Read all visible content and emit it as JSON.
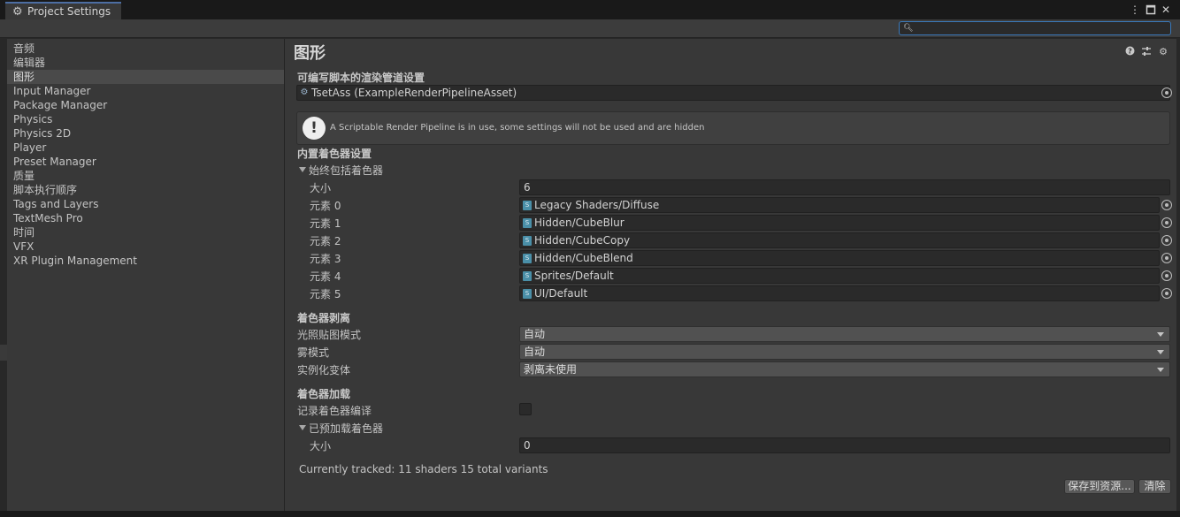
{
  "window": {
    "tab_title": "Project Settings",
    "menu_icon": "kebab-menu-icon",
    "maximize_icon": "maximize-icon",
    "close_icon": "close-icon"
  },
  "search": {
    "placeholder": "",
    "value": "",
    "icon": "search-icon"
  },
  "sidebar": {
    "items": [
      {
        "label": "音频",
        "selected": false
      },
      {
        "label": "编辑器",
        "selected": false
      },
      {
        "label": "图形",
        "selected": true
      },
      {
        "label": "Input Manager",
        "selected": false
      },
      {
        "label": "Package Manager",
        "selected": false
      },
      {
        "label": "Physics",
        "selected": false
      },
      {
        "label": "Physics 2D",
        "selected": false
      },
      {
        "label": "Player",
        "selected": false
      },
      {
        "label": "Preset Manager",
        "selected": false
      },
      {
        "label": "质量",
        "selected": false
      },
      {
        "label": "脚本执行顺序",
        "selected": false
      },
      {
        "label": "Tags and Layers",
        "selected": false
      },
      {
        "label": "TextMesh Pro",
        "selected": false
      },
      {
        "label": "时间",
        "selected": false
      },
      {
        "label": "VFX",
        "selected": false
      },
      {
        "label": "XR Plugin Management",
        "selected": false
      }
    ]
  },
  "main": {
    "title": "图形",
    "header_icons": [
      "help-icon",
      "preset-icon",
      "gear-icon"
    ],
    "srp": {
      "section": "可编写脚本的渲染管道设置",
      "asset_value": "TsetAss (ExampleRenderPipelineAsset)"
    },
    "help_message": "A Scriptable Render Pipeline is in use, some settings will not be used and are hidden",
    "builtin": {
      "section": "内置着色器设置",
      "always_include_label": "始终包括着色器",
      "size_label": "大小",
      "size_value": "6",
      "elements": [
        {
          "label": "元素 0",
          "value": "Legacy Shaders/Diffuse"
        },
        {
          "label": "元素 1",
          "value": "Hidden/CubeBlur"
        },
        {
          "label": "元素 2",
          "value": "Hidden/CubeCopy"
        },
        {
          "label": "元素 3",
          "value": "Hidden/CubeBlend"
        },
        {
          "label": "元素 4",
          "value": "Sprites/Default"
        },
        {
          "label": "元素 5",
          "value": "UI/Default"
        }
      ]
    },
    "stripping": {
      "section": "着色器剥离",
      "rows": [
        {
          "label": "光照贴图模式",
          "value": "自动"
        },
        {
          "label": "雾模式",
          "value": "自动"
        },
        {
          "label": "实例化变体",
          "value": "剥离未使用"
        }
      ]
    },
    "loading": {
      "section": "着色器加载",
      "log_label": "记录着色器编译",
      "log_checked": false,
      "preloaded_label": "已预加载着色器",
      "size_label": "大小",
      "size_value": "0"
    },
    "tracked_text": "Currently tracked: 11 shaders 15 total variants",
    "save_button": "保存到资源...",
    "clear_button": "清除"
  }
}
